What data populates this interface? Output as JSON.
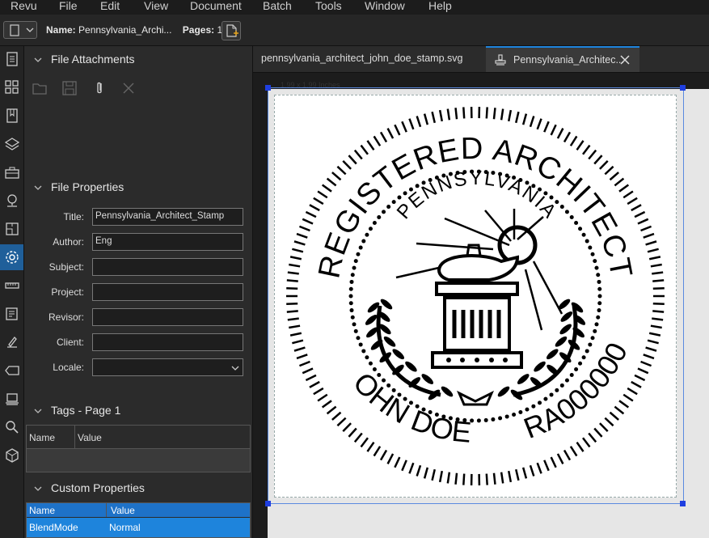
{
  "menu": [
    "Revu",
    "File",
    "Edit",
    "View",
    "Document",
    "Batch",
    "Tools",
    "Window",
    "Help"
  ],
  "toolbar": {
    "name_label": "Name:",
    "name_value": "Pennsylvania_Archi...",
    "pages_label": "Pages:",
    "pages_value": "1"
  },
  "sidebar_icons": [
    "thumbnails-icon",
    "grid-icon",
    "bookmarks-icon",
    "layers-icon",
    "toolbox-icon",
    "places-icon",
    "forms-icon",
    "properties-icon",
    "measure-icon",
    "markups-icon",
    "signatures-icon",
    "tags-icon",
    "stack-icon",
    "search-icon",
    "3d-icon"
  ],
  "panel": {
    "attachments_title": "File Attachments",
    "properties_title": "File Properties",
    "props": [
      {
        "label": "Title:",
        "value": "Pennsylvania_Architect_Stamp"
      },
      {
        "label": "Author:",
        "value": "Eng"
      },
      {
        "label": "Subject:",
        "value": ""
      },
      {
        "label": "Project:",
        "value": ""
      },
      {
        "label": "Revisor:",
        "value": ""
      },
      {
        "label": "Client:",
        "value": ""
      },
      {
        "label": "Locale:",
        "value": ""
      }
    ],
    "tags_title": "Tags - Page 1",
    "tags_col_name": "Name",
    "tags_col_value": "Value",
    "custom_title": "Custom Properties",
    "custom_col_name": "Name",
    "custom_col_value": "Value",
    "custom_row_name": "BlendMode",
    "custom_row_value": "Normal"
  },
  "tabs": [
    {
      "label": "pennsylvania_architect_john_doe_stamp.svg"
    },
    {
      "label": "Pennsylvania_Architec..."
    }
  ],
  "canvas": {
    "size_label": "1.99 x 1.99 Inches"
  },
  "stamp": {
    "top_text": "REGISTERED ARCHITECT",
    "inner_text": "PENNSYLVANIA",
    "name": "JOHN DOE",
    "number": "RA000000"
  }
}
